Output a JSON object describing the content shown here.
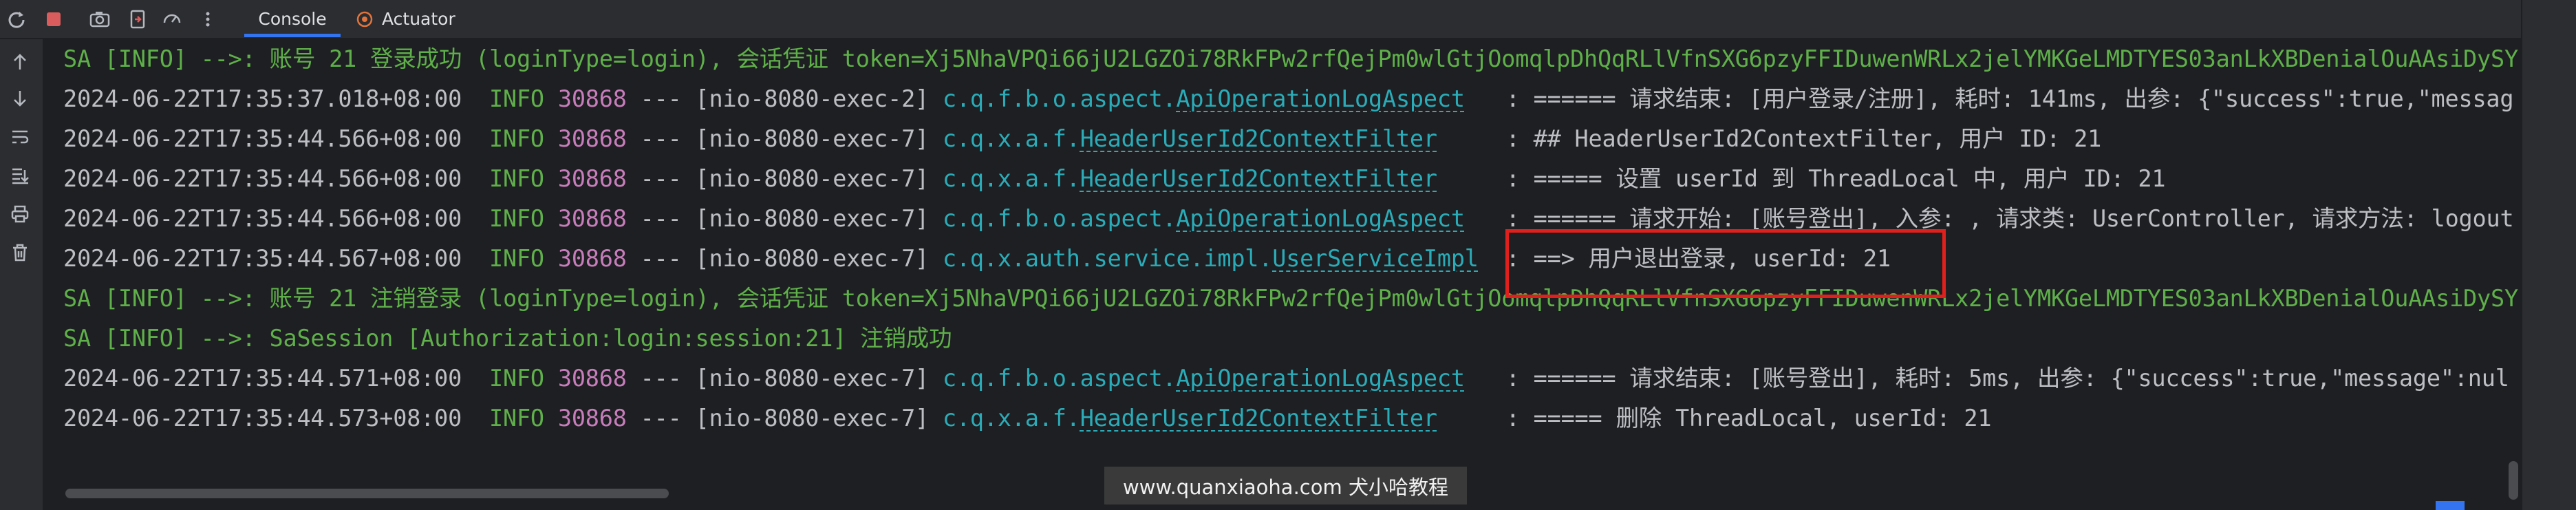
{
  "tabs": [
    {
      "label": "Console",
      "active": true
    },
    {
      "label": "Actuator",
      "active": false
    }
  ],
  "toolbar_icons": [
    "rerun-icon",
    "stop-icon",
    "camera-icon",
    "export-icon",
    "speed-icon",
    "more-icon"
  ],
  "gutter_icons": [
    "scroll-up-icon",
    "scroll-down-icon",
    "soft-wrap-icon",
    "scroll-to-end-icon",
    "print-icon",
    "trash-icon"
  ],
  "log_lines": [
    {
      "segments": [
        {
          "t": "SA [INFO] -->: 账号 21 登录成功 (loginType=login), 会话凭证 token=Xj5NhaVPQi66jU2LGZOi78RkFPw2rfQejPm0wlGtjOomqlpDhQqRLlVfnSXG6pzyFFIDuwenWRLx2jelYMKGeLMDTYES03anLkXBDenialOuAAsiDySY",
          "c": "c-green"
        }
      ]
    },
    {
      "segments": [
        {
          "t": "2024-06-22T17:35:37.018+08:00  ",
          "c": "c-plain"
        },
        {
          "t": "INFO ",
          "c": "c-info"
        },
        {
          "t": "30868",
          "c": "c-pid"
        },
        {
          "t": " --- [nio-8080-exec-2] ",
          "c": "c-plain"
        },
        {
          "t": "c.q.f.b.o.aspect.",
          "c": "c-teal"
        },
        {
          "t": "ApiOperationLogAspect",
          "c": "c-link"
        },
        {
          "t": "   : ====== 请求结束: [用户登录/注册], 耗时: 141ms, 出参: {\"success\":true,\"messag",
          "c": "c-plain"
        }
      ]
    },
    {
      "segments": [
        {
          "t": "2024-06-22T17:35:44.566+08:00  ",
          "c": "c-plain"
        },
        {
          "t": "INFO ",
          "c": "c-info"
        },
        {
          "t": "30868",
          "c": "c-pid"
        },
        {
          "t": " --- [nio-8080-exec-7] ",
          "c": "c-plain"
        },
        {
          "t": "c.q.x.a.f.",
          "c": "c-teal"
        },
        {
          "t": "HeaderUserId2ContextFilter",
          "c": "c-link"
        },
        {
          "t": "     : ## HeaderUserId2ContextFilter, 用户 ID: 21",
          "c": "c-plain"
        }
      ]
    },
    {
      "segments": [
        {
          "t": "2024-06-22T17:35:44.566+08:00  ",
          "c": "c-plain"
        },
        {
          "t": "INFO ",
          "c": "c-info"
        },
        {
          "t": "30868",
          "c": "c-pid"
        },
        {
          "t": " --- [nio-8080-exec-7] ",
          "c": "c-plain"
        },
        {
          "t": "c.q.x.a.f.",
          "c": "c-teal"
        },
        {
          "t": "HeaderUserId2ContextFilter",
          "c": "c-link"
        },
        {
          "t": "     : ===== 设置 userId 到 ThreadLocal 中, 用户 ID: 21",
          "c": "c-plain"
        }
      ]
    },
    {
      "segments": [
        {
          "t": "2024-06-22T17:35:44.566+08:00  ",
          "c": "c-plain"
        },
        {
          "t": "INFO ",
          "c": "c-info"
        },
        {
          "t": "30868",
          "c": "c-pid"
        },
        {
          "t": " --- [nio-8080-exec-7] ",
          "c": "c-plain"
        },
        {
          "t": "c.q.f.b.o.aspect.",
          "c": "c-teal"
        },
        {
          "t": "ApiOperationLogAspect",
          "c": "c-link"
        },
        {
          "t": "   : ====== 请求开始: [账号登出], 入参: , 请求类: UserController, 请求方法: logout",
          "c": "c-plain"
        }
      ]
    },
    {
      "segments": [
        {
          "t": "2024-06-22T17:35:44.567+08:00  ",
          "c": "c-plain"
        },
        {
          "t": "INFO ",
          "c": "c-info"
        },
        {
          "t": "30868",
          "c": "c-pid"
        },
        {
          "t": " --- [nio-8080-exec-7] ",
          "c": "c-plain"
        },
        {
          "t": "c.q.x.auth.service.impl.",
          "c": "c-teal"
        },
        {
          "t": "UserServiceImpl",
          "c": "c-link"
        },
        {
          "t": "  : ==> 用户退出登录, userId: 21",
          "c": "c-plain"
        }
      ]
    },
    {
      "segments": [
        {
          "t": "SA [INFO] -->: 账号 21 注销登录 (loginType=login), 会话凭证 token=Xj5NhaVPQi66jU2LGZOi78RkFPw2rfQejPm0wlGtjOomqlpDhQqRLlVfnSXG6pzyFFIDuwenWRLx2jelYMKGeLMDTYES03anLkXBDenialOuAAsiDySY",
          "c": "c-green"
        }
      ]
    },
    {
      "segments": [
        {
          "t": "SA [INFO] -->: SaSession [Authorization:login:session:21] 注销成功",
          "c": "c-green"
        }
      ]
    },
    {
      "segments": [
        {
          "t": "2024-06-22T17:35:44.571+08:00  ",
          "c": "c-plain"
        },
        {
          "t": "INFO ",
          "c": "c-info"
        },
        {
          "t": "30868",
          "c": "c-pid"
        },
        {
          "t": " --- [nio-8080-exec-7] ",
          "c": "c-plain"
        },
        {
          "t": "c.q.f.b.o.aspect.",
          "c": "c-teal"
        },
        {
          "t": "ApiOperationLogAspect",
          "c": "c-link"
        },
        {
          "t": "   : ====== 请求结束: [账号登出], 耗时: 5ms, 出参: {\"success\":true,\"message\":nul",
          "c": "c-plain"
        }
      ]
    },
    {
      "segments": [
        {
          "t": "2024-06-22T17:35:44.573+08:00  ",
          "c": "c-plain"
        },
        {
          "t": "INFO ",
          "c": "c-info"
        },
        {
          "t": "30868",
          "c": "c-pid"
        },
        {
          "t": " --- [nio-8080-exec-7] ",
          "c": "c-plain"
        },
        {
          "t": "c.q.x.a.f.",
          "c": "c-teal"
        },
        {
          "t": "HeaderUserId2ContextFilter",
          "c": "c-link"
        },
        {
          "t": "     : ===== 删除 ThreadLocal, userId: 21",
          "c": "c-plain"
        }
      ]
    }
  ],
  "watermark": "www.quanxiaoha.com 犬小哈教程",
  "colors": {
    "background": "#1e1f22",
    "panel": "#2b2d30",
    "green": "#5fb04a",
    "pid": "#c77dbb",
    "teal": "#2aacb8",
    "text": "#bcbec4",
    "highlight": "#e0201c",
    "accent": "#3574f0"
  }
}
